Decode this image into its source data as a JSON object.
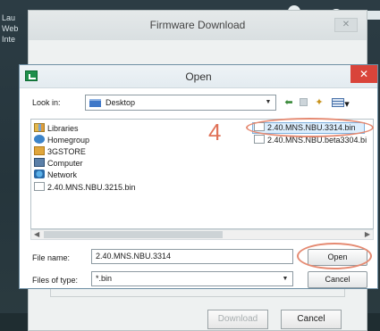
{
  "background": {
    "left_text_lines": [
      "Lau",
      "Web",
      "Inte"
    ]
  },
  "firmware_dialog": {
    "title": "Firmware Download",
    "close_label": "✕",
    "download_label": "Download",
    "cancel_label": "Cancel"
  },
  "open_dialog": {
    "title": "Open",
    "close_label": "✕",
    "look_in_label": "Look in:",
    "look_in_value": "Desktop",
    "toolbar_icons": [
      "back-arrow-icon",
      "up-folder-icon",
      "new-folder-icon",
      "view-menu-icon"
    ],
    "places": [
      {
        "label": "Libraries",
        "icon": "libraries-icon"
      },
      {
        "label": "Homegroup",
        "icon": "homegroup-icon"
      },
      {
        "label": "3GSTORE",
        "icon": "user-folder-icon"
      },
      {
        "label": "Computer",
        "icon": "computer-icon"
      },
      {
        "label": "Network",
        "icon": "network-icon"
      },
      {
        "label": "2.40.MNS.NBU.3215.bin",
        "icon": "file-icon"
      }
    ],
    "right_files": [
      {
        "label": "2.40.MNS.NBU.3314.bin",
        "selected": true
      },
      {
        "label": "2.40.MNS.NBU.beta3304.bi",
        "selected": false
      }
    ],
    "annotation_number": "4",
    "annotation_color": "#e58a72",
    "file_name_label": "File name:",
    "file_name_value": "2.40.MNS.NBU.3314",
    "files_of_type_label": "Files of type:",
    "files_of_type_value": "*.bin",
    "open_button": "Open",
    "cancel_button": "Cancel"
  }
}
